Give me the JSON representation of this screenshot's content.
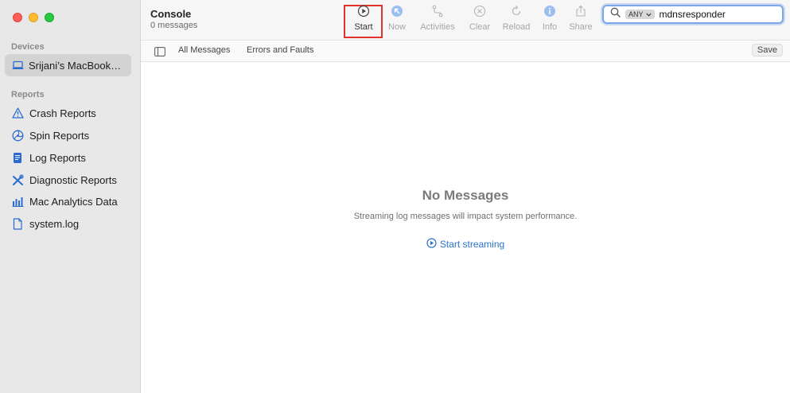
{
  "sidebar": {
    "devices_label": "Devices",
    "device": {
      "label": "Srijani’s MacBook…",
      "icon": "laptop-icon"
    },
    "reports_label": "Reports",
    "items": [
      {
        "label": "Crash Reports",
        "icon": "warning-triangle-icon"
      },
      {
        "label": "Spin Reports",
        "icon": "spin-wheel-icon"
      },
      {
        "label": "Log Reports",
        "icon": "document-icon"
      },
      {
        "label": "Diagnostic Reports",
        "icon": "tools-icon"
      },
      {
        "label": "Mac Analytics Data",
        "icon": "bar-chart-icon"
      },
      {
        "label": "system.log",
        "icon": "file-icon"
      }
    ]
  },
  "toolbar": {
    "title": "Console",
    "subtitle": "0 messages",
    "buttons": [
      {
        "label": "Start",
        "icon": "play-circle-icon",
        "enabled": true
      },
      {
        "label": "Now",
        "icon": "arrow-up-left-circle-icon",
        "enabled": false
      },
      {
        "label": "Activities",
        "icon": "activities-icon",
        "enabled": false
      },
      {
        "label": "Clear",
        "icon": "x-circle-icon",
        "enabled": false
      },
      {
        "label": "Reload",
        "icon": "reload-icon",
        "enabled": false
      },
      {
        "label": "Info",
        "icon": "info-icon",
        "enabled": false
      },
      {
        "label": "Share",
        "icon": "share-icon",
        "enabled": false
      }
    ]
  },
  "search": {
    "token": "ANY",
    "value": "mdnsresponder"
  },
  "filterbar": {
    "tabs": [
      "All Messages",
      "Errors and Faults"
    ],
    "save_label": "Save"
  },
  "empty_state": {
    "title": "No Messages",
    "subtitle": "Streaming log messages will impact system performance.",
    "link": "Start streaming"
  },
  "colors": {
    "highlight": "#e0332c",
    "link": "#2a73d0",
    "search_focus": "#7aa7e8"
  }
}
